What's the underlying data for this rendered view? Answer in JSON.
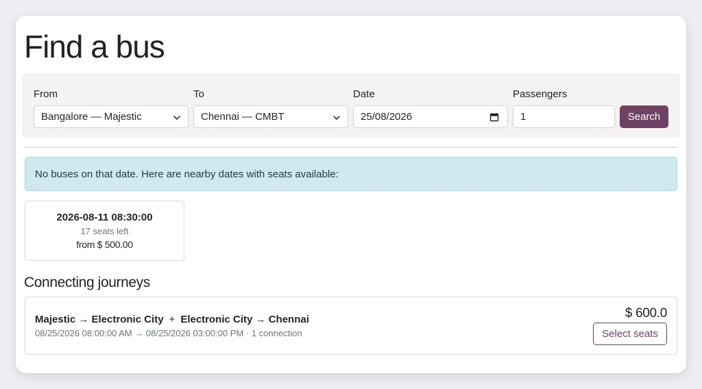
{
  "page": {
    "title": "Find a bus"
  },
  "search": {
    "from_label": "From",
    "from_value": "Bangalore — Majestic",
    "to_label": "To",
    "to_value": "Chennai — CMBT",
    "date_label": "Date",
    "date_value": "25/08/2026",
    "passengers_label": "Passengers",
    "passengers_value": "1",
    "search_button": "Search"
  },
  "alert": {
    "text": "No buses on that date. Here are nearby dates with seats available:"
  },
  "nearby_dates": [
    {
      "date": "2026-08-11 08:30:00",
      "seats": "17 seats left",
      "price": "from $ 500.00"
    }
  ],
  "connecting": {
    "title": "Connecting journeys",
    "journeys": [
      {
        "leg1": "Majestic → Electronic City",
        "plus": "+",
        "leg2": "Electronic City → Chennai",
        "meta": "08/25/2026 08:00:00 AM → 08/25/2026 03:00:00 PM · 1 connection",
        "price": "$ 600.0",
        "button": "Select seats"
      }
    ]
  },
  "colors": {
    "primary": "#6f4263",
    "alert_bg": "#cfe9ef",
    "panel_bg": "#f4f3f1"
  },
  "icons": {
    "select_chevron": "chevron-down-icon",
    "date_picker": "calendar-icon"
  }
}
